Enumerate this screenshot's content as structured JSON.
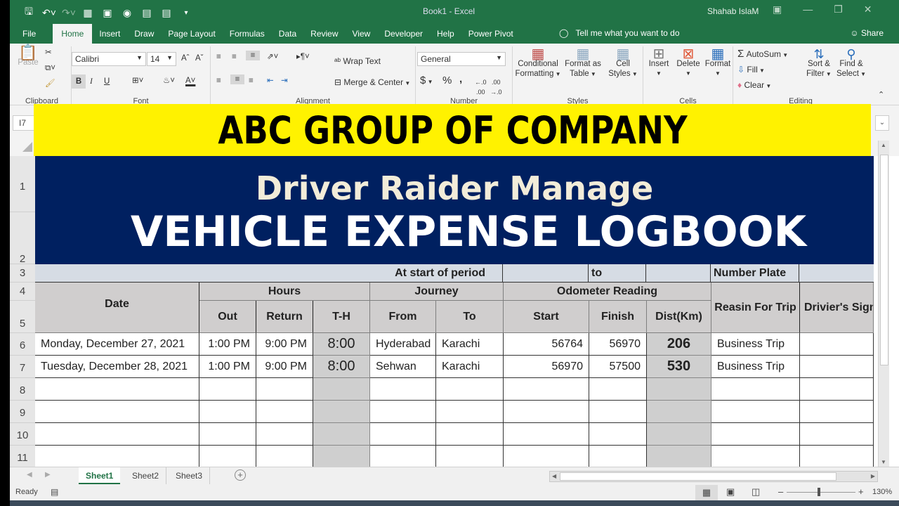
{
  "window": {
    "title": "Book1  -  Excel",
    "user": "Shahab IslaM",
    "controls": [
      "ribbon-display",
      "minimize",
      "restore",
      "close"
    ]
  },
  "quick_access": [
    "save-icon",
    "undo-icon",
    "redo-icon",
    "form-icon",
    "freeze-icon",
    "camera-icon",
    "calculator-icon",
    "table-icon",
    "customize-icon"
  ],
  "tabs": [
    "File",
    "Home",
    "Insert",
    "Draw",
    "Page Layout",
    "Formulas",
    "Data",
    "Review",
    "View",
    "Developer",
    "Help",
    "Power Pivot"
  ],
  "active_tab": "Home",
  "tell_me": "Tell me what you want to do",
  "share": "Share",
  "ribbon": {
    "clipboard": {
      "label": "Clipboard",
      "paste": "Paste"
    },
    "font": {
      "label": "Font",
      "name": "Calibri",
      "size": "14",
      "bold": "B",
      "italic": "I",
      "underline": "U"
    },
    "alignment": {
      "label": "Alignment",
      "wrap": "Wrap Text",
      "merge": "Merge & Center"
    },
    "number": {
      "label": "Number",
      "format": "General",
      "currency": "$",
      "percent": "%",
      "comma": ","
    },
    "styles": {
      "label": "Styles",
      "conditional": [
        "Conditional",
        "Formatting"
      ],
      "format_table": [
        "Format as",
        "Table"
      ],
      "cell_styles": [
        "Cell",
        "Styles"
      ]
    },
    "cells": {
      "label": "Cells",
      "insert": "Insert",
      "delete": "Delete",
      "format": "Format"
    },
    "editing": {
      "label": "Editing",
      "autosum": "AutoSum",
      "fill": "Fill",
      "clear": "Clear",
      "sort": [
        "Sort &",
        "Filter"
      ],
      "find": [
        "Find &",
        "Select"
      ]
    }
  },
  "name_box": "I7",
  "sheet": {
    "banner_company": "ABC GROUP OF COMPANY",
    "subtitle": "Driver Raider Manage",
    "title": "VEHICLE EXPENSE LOGBOOK",
    "row3": {
      "period": "At start of period",
      "to": "to",
      "plate": "Number Plate"
    },
    "headers": {
      "date": "Date",
      "hours": "Hours",
      "out": "Out",
      "return": "Return",
      "th": "T-H",
      "journey": "Journey",
      "from": "From",
      "to": "To",
      "odometer": "Odometer Reading",
      "start": "Start",
      "finish": "Finish",
      "dist": "Dist(Km)",
      "reason": "Reasin For Trip",
      "sign": "Drivier's Sign"
    },
    "rows": [
      {
        "date": "Monday, December 27, 2021",
        "out": "1:00 PM",
        "return": "9:00 PM",
        "th": "8:00",
        "from": "Hyderabad",
        "to": "Karachi",
        "start": "56764",
        "finish": "56970",
        "dist": "206",
        "reason": "Business Trip",
        "sign": ""
      },
      {
        "date": "Tuesday, December 28, 2021",
        "out": "1:00 PM",
        "return": "9:00 PM",
        "th": "8:00",
        "from": "Sehwan",
        "to": "Karachi",
        "start": "56970",
        "finish": "57500",
        "dist": "530",
        "reason": "Business Trip",
        "sign": ""
      }
    ],
    "row_numbers": [
      "1",
      "2",
      "3",
      "4",
      "5",
      "6",
      "7",
      "8",
      "9",
      "10",
      "11"
    ]
  },
  "sheet_tabs": [
    "Sheet1",
    "Sheet2",
    "Sheet3"
  ],
  "active_sheet": "Sheet1",
  "status": {
    "ready": "Ready",
    "zoom": "130%"
  },
  "colors": {
    "excel_green": "#217346",
    "banner_yellow": "#fff200",
    "banner_navy": "#002060",
    "header_grey": "#d0cece",
    "period_blue": "#d6dce4"
  }
}
